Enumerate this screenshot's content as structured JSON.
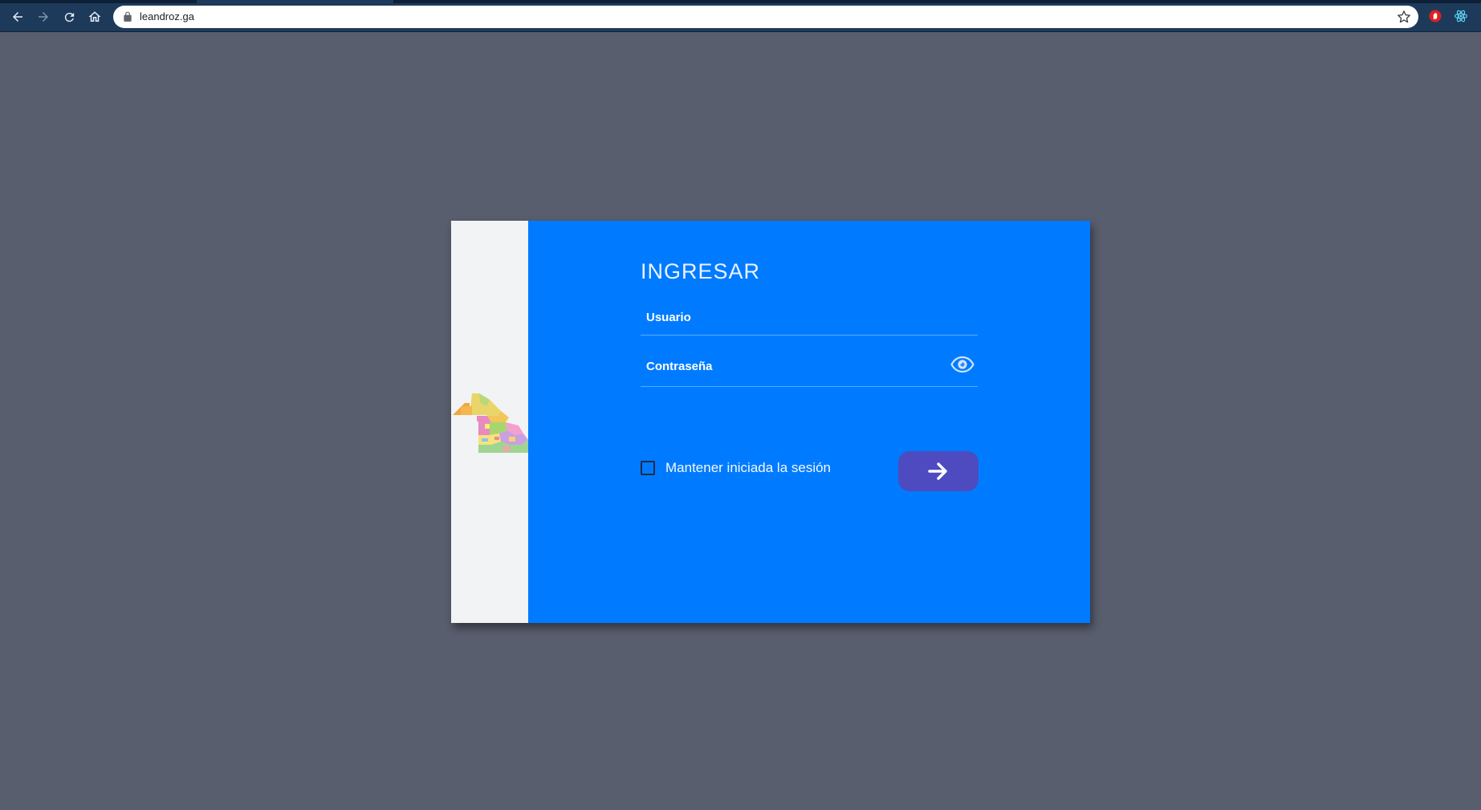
{
  "browser": {
    "url": "leandroz.ga",
    "icons": {
      "back": "arrow-left-icon",
      "forward": "arrow-right-icon",
      "reload": "reload-icon",
      "home": "home-icon",
      "lock": "lock-icon",
      "bookmark": "star-icon",
      "extension_1": "red-hand-extension-icon",
      "extension_2": "react-devtools-icon"
    }
  },
  "login": {
    "title": "INGRESAR",
    "username_placeholder": "Usuario",
    "password_placeholder": "Contraseña",
    "remember_label": "Mantener iniciada la sesión",
    "remember_checked": false,
    "show_password_icon": "eye-icon",
    "submit_icon": "arrow-right-icon",
    "logo_icon": "province-map-icon"
  },
  "colors": {
    "page_background": "#585e6e",
    "browser_chrome": "#1d3a5b",
    "card_accent": "#007bff",
    "card_side": "#f1f3f4",
    "submit_button": "#4d4bbf"
  }
}
